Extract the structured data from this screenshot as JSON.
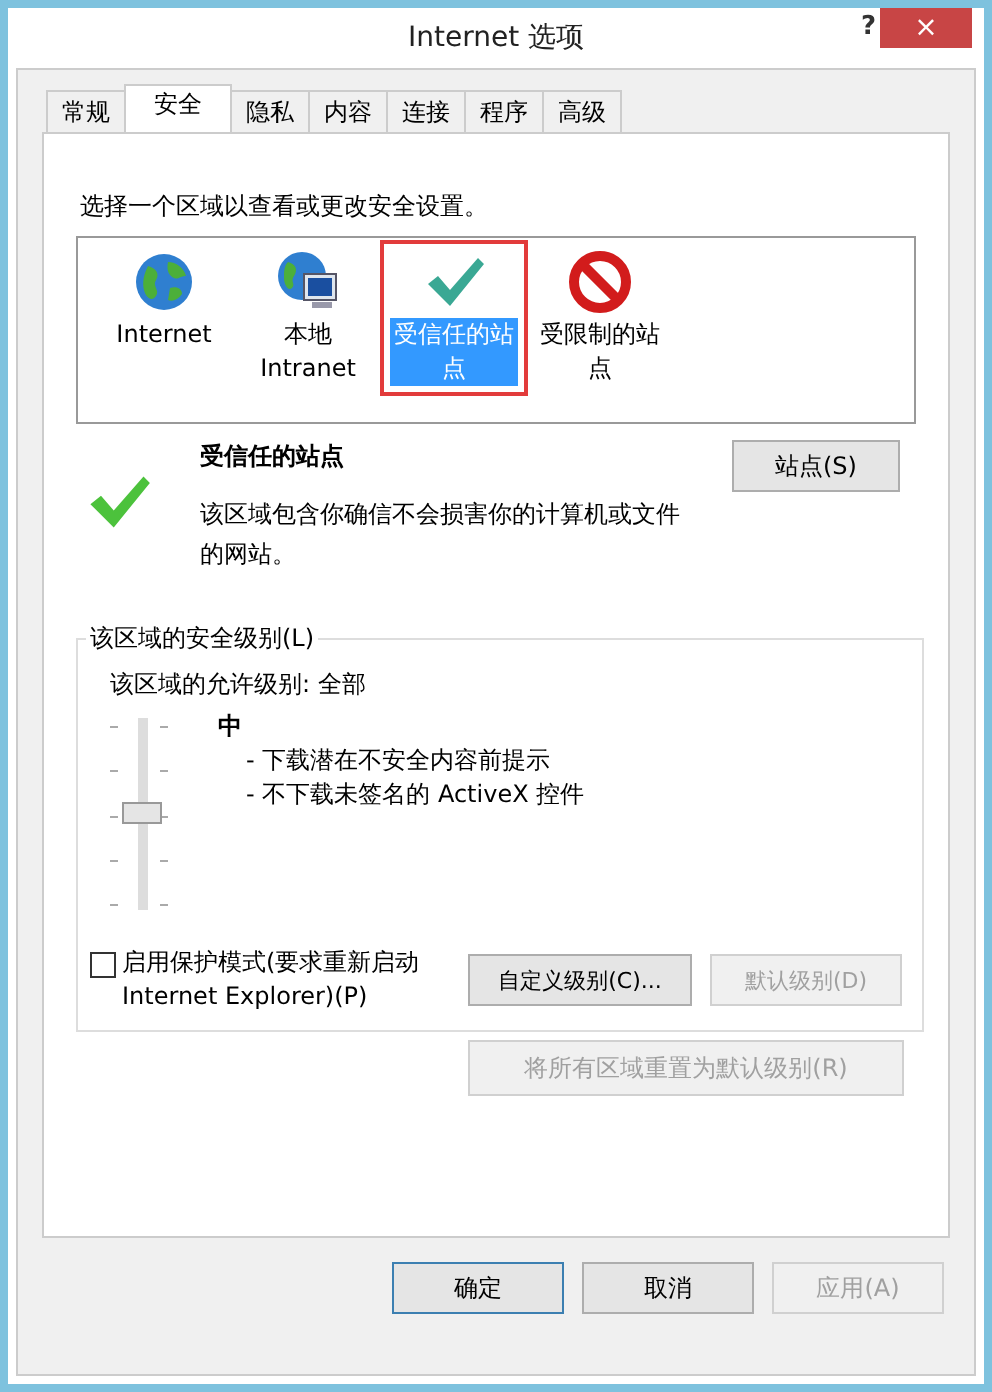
{
  "window": {
    "title": "Internet 选项",
    "help": "?",
    "close": "×"
  },
  "tabs": [
    {
      "label": "常规",
      "selected": false
    },
    {
      "label": "安全",
      "selected": true
    },
    {
      "label": "隐私",
      "selected": false
    },
    {
      "label": "内容",
      "selected": false
    },
    {
      "label": "连接",
      "selected": false
    },
    {
      "label": "程序",
      "selected": false
    },
    {
      "label": "高级",
      "selected": false
    }
  ],
  "zone_prompt": "选择一个区域以查看或更改安全设置。",
  "zones": [
    {
      "label": "Internet",
      "kind": "globe",
      "selected": false
    },
    {
      "label": "本地 Intranet",
      "kind": "intranet",
      "selected": false
    },
    {
      "label": "受信任的站点",
      "kind": "trusted",
      "selected": true
    },
    {
      "label": "受限制的站点",
      "kind": "restricted",
      "selected": false
    }
  ],
  "zone_detail": {
    "title": "受信任的站点",
    "description": "该区域包含你确信不会损害你的计算机或文件的网站。",
    "sites_button": "站点(S)"
  },
  "security_level": {
    "legend": "该区域的安全级别(L)",
    "allowed": "该区域的允许级别: 全部",
    "level": 0.5,
    "level_name": "中",
    "bullets": [
      "- 下载潜在不安全内容前提示",
      "- 不下载未签名的 ActiveX 控件"
    ],
    "protected_mode": {
      "label": "启用保护模式(要求重新启动 Internet Explorer)(P)",
      "checked": false
    },
    "buttons": [
      {
        "label": "自定义级别(C)...",
        "disabled": false
      },
      {
        "label": "默认级别(D)",
        "disabled": true
      }
    ]
  },
  "reset_all": {
    "label": "将所有区域重置为默认级别(R)",
    "disabled": true
  },
  "footer_buttons": [
    {
      "label": "确定",
      "disabled": false,
      "default": true
    },
    {
      "label": "取消",
      "disabled": false,
      "default": false
    },
    {
      "label": "应用(A)",
      "disabled": true,
      "default": false
    }
  ]
}
